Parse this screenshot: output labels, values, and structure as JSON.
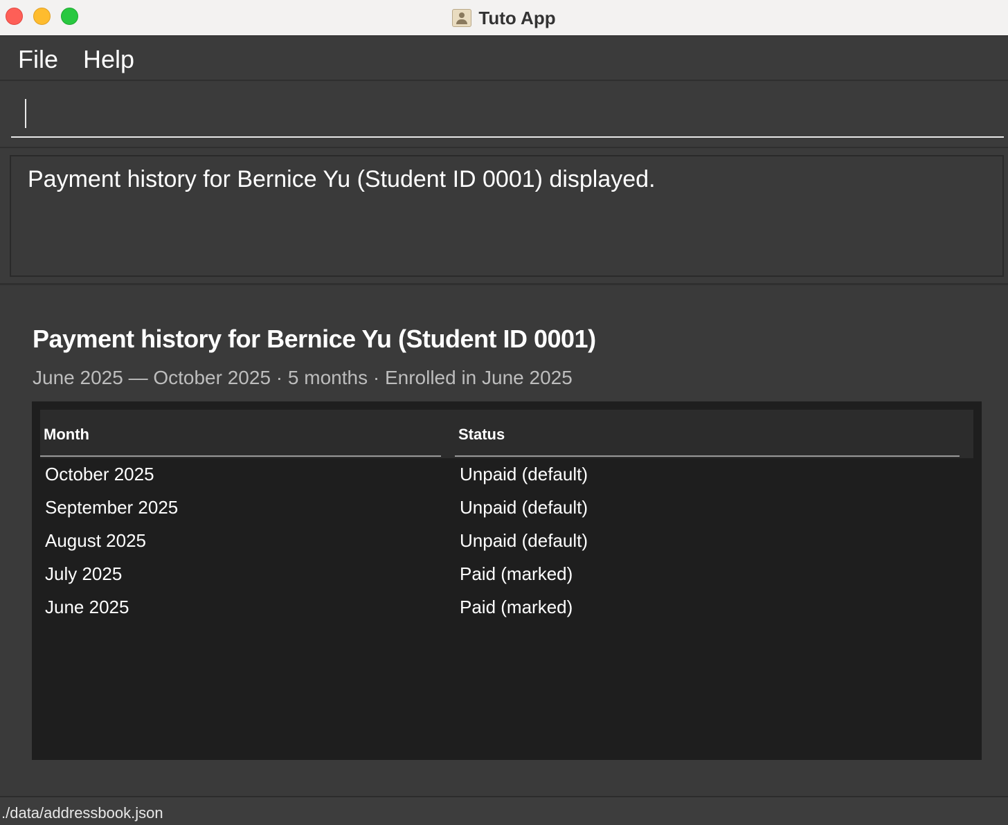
{
  "window": {
    "title": "Tuto App"
  },
  "menu": {
    "file_label": "File",
    "help_label": "Help"
  },
  "command": {
    "value": "",
    "placeholder": ""
  },
  "result": {
    "message": "Payment history for Bernice Yu (Student ID 0001) displayed."
  },
  "panel": {
    "heading": "Payment history for Bernice Yu (Student ID 0001)",
    "subheading": "June 2025 — October 2025 · 5 months · Enrolled in June 2025",
    "table": {
      "columns": [
        "Month",
        "Status"
      ],
      "rows": [
        {
          "month": "October 2025",
          "status": "Unpaid (default)"
        },
        {
          "month": "September 2025",
          "status": "Unpaid (default)"
        },
        {
          "month": "August 2025",
          "status": "Unpaid (default)"
        },
        {
          "month": "July 2025",
          "status": "Paid (marked)"
        },
        {
          "month": "June 2025",
          "status": "Paid (marked)"
        }
      ]
    }
  },
  "statusbar": {
    "path": "./data/addressbook.json"
  },
  "colors": {
    "background": "#3a3a3a",
    "table_background": "#1e1e1e",
    "close": "#fe5f57",
    "minimize": "#febc2e",
    "zoom": "#28c840"
  },
  "icons": {
    "app": "contacts-book-icon"
  }
}
